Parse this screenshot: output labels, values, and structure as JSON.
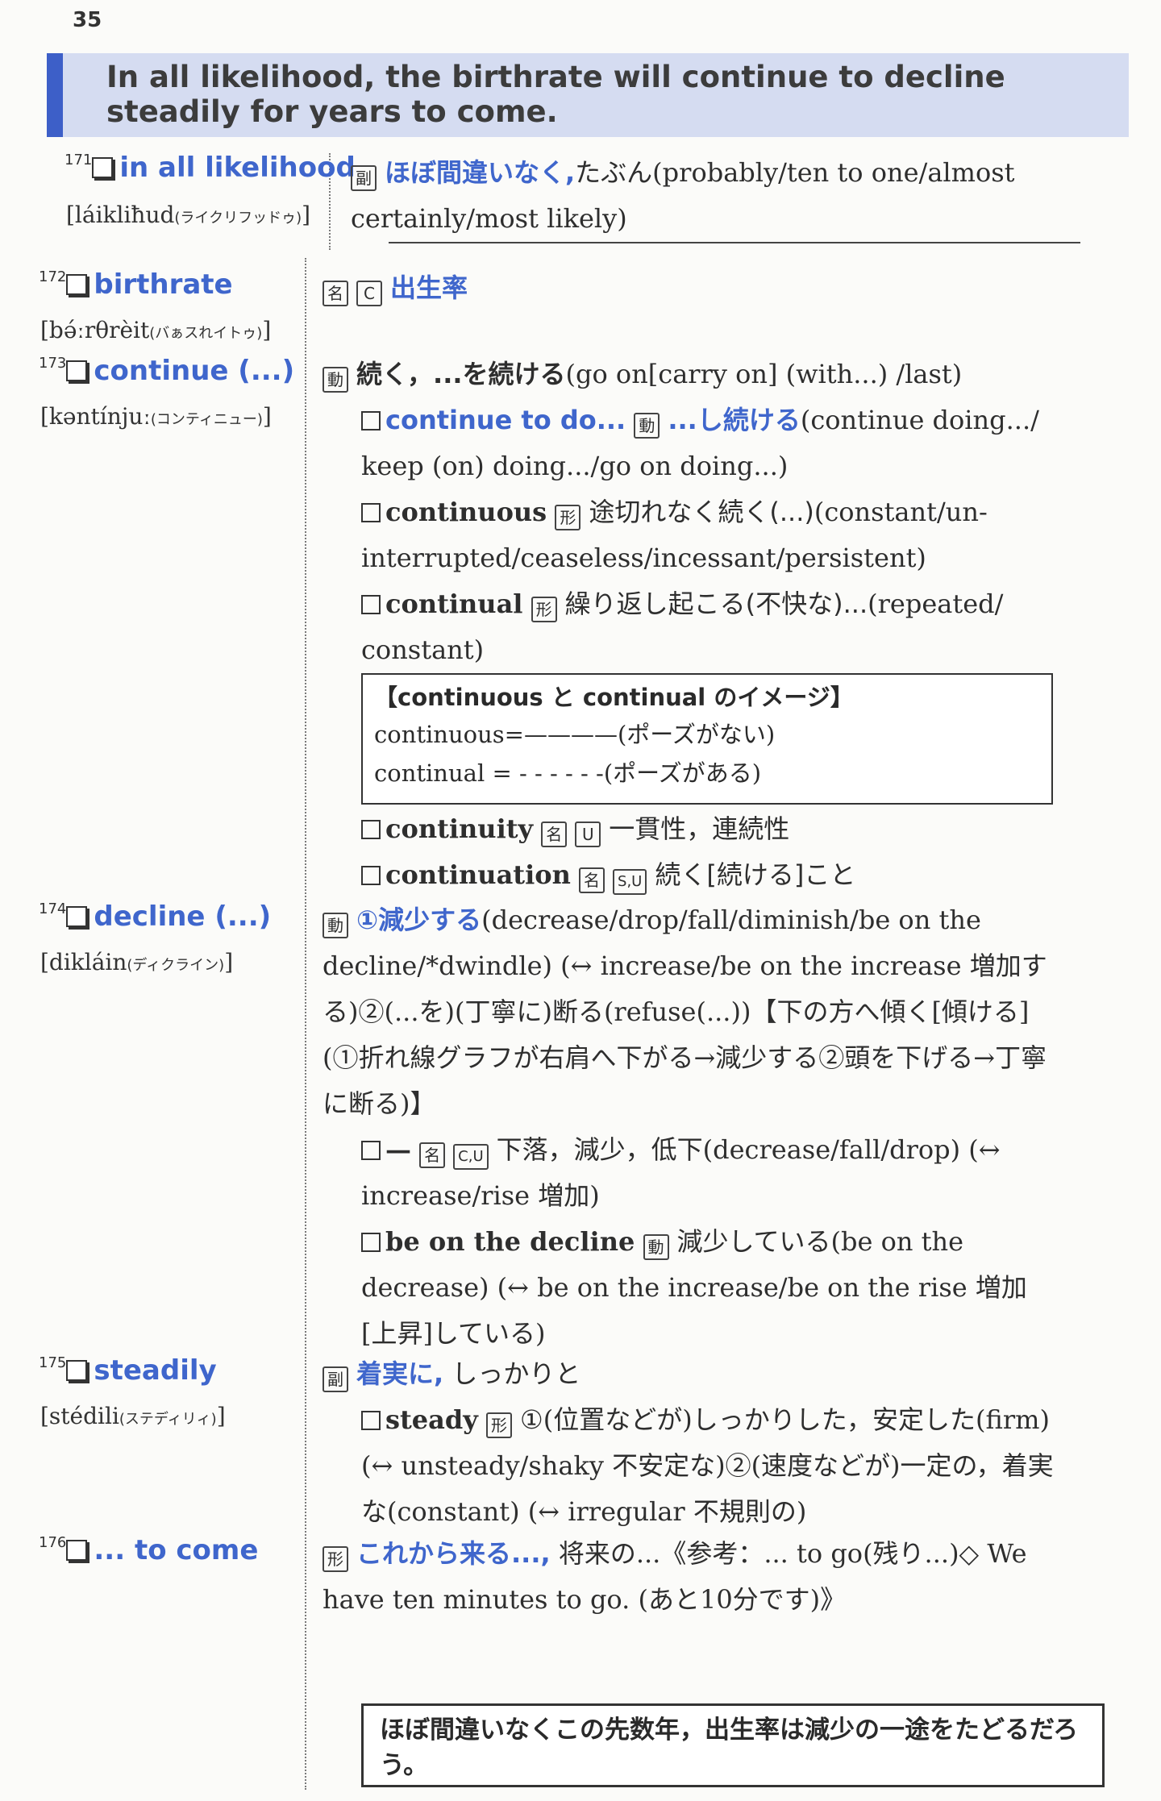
{
  "page_number": "35",
  "headline": "In all likelihood, the birthrate will continue to decline steadily for years to come.",
  "entries": [
    {
      "num": "171",
      "word": "in all likelihood",
      "pron": "[láikliħud",
      "pron_kana": "(ライクリフッドゥ)",
      "pron_end": "]",
      "pos": "副",
      "def_blue": "ほぼ間違いなく,",
      "def_rest": "たぶん(probably/ten to one/almost certainly/most likely)"
    },
    {
      "num": "172",
      "word": "birthrate",
      "pron": "[bə́ːrθrèit",
      "pron_kana": "(バぁスれイトゥ)",
      "pron_end": "]",
      "pos": "名",
      "pos2": "C",
      "def_blue": "出生率"
    },
    {
      "num": "173",
      "word": "continue (...)",
      "pron": "[kəntínjuː",
      "pron_kana": "(コンティニュー)",
      "pron_end": "]",
      "pos": "動",
      "def_main": "続く，...を続ける",
      "def_rest": "(go on[carry on] (with...) /last)",
      "sub1_word": "continue to do...",
      "sub1_pos": "動",
      "sub1_jp": "...し続ける",
      "sub1_rest": "(continue doing.../ keep (on) doing.../go on doing...)",
      "sub2_word": "continuous",
      "sub2_pos": "形",
      "sub2_jp": "途切れなく続く(...)",
      "sub2_rest": "(constant/un-interrupted/ceaseless/incessant/persistent)",
      "sub3_word": "continual",
      "sub3_pos": "形",
      "sub3_jp": "繰り返し起こる(不快な)...",
      "sub3_rest": "(repeated/ constant)",
      "image_title": "【continuous と continual のイメージ】",
      "image_line1": "continuous=————(ポーズがない)",
      "image_line2": "continual = - - - - - -(ポーズがある)",
      "sub4_word": "continuity",
      "sub4_pos": "名",
      "sub4_pos2": "U",
      "sub4_jp": "一貫性，連続性",
      "sub5_word": "continuation",
      "sub5_pos": "名",
      "sub5_pos2": "S,U",
      "sub5_jp": "続く[続ける]こと"
    },
    {
      "num": "174",
      "word": "decline (...)",
      "pron": "[dikláin",
      "pron_kana": "(ディクライン)",
      "pron_end": "]",
      "pos": "動",
      "def_blue": "①減少する",
      "def_rest": "(decrease/drop/fall/diminish/be on the decline/*dwindle) (↔ increase/be on the increase 増加する)②(...を)(丁寧に)断る(refuse(...))【下の方へ傾く[傾ける](①折れ線グラフが右肩へ下がる→減少する②頭を下げる→丁寧に断る)】",
      "sub1_word": "—",
      "sub1_pos": "名",
      "sub1_pos2": "C,U",
      "sub1_rest": "下落，減少，低下(decrease/fall/drop) (↔ increase/rise 増加)",
      "sub2_word": "be on the decline",
      "sub2_pos": "動",
      "sub2_rest": "減少している(be on the decrease) (↔ be on the increase/be on the rise 増加[上昇]している)"
    },
    {
      "num": "175",
      "word": "steadily",
      "pron": "[stédili",
      "pron_kana": "(ステディリィ)",
      "pron_end": "]",
      "pos": "副",
      "def_blue": "着実に,",
      "def_rest": "しっかりと",
      "sub1_word": "steady",
      "sub1_pos": "形",
      "sub1_rest": "①(位置などが)しっかりした，安定した(firm) (↔ unsteady/shaky 不安定な)②(速度などが)一定の，着実な(constant) (↔ irregular 不規則の)"
    },
    {
      "num": "176",
      "word": "... to come",
      "pos": "形",
      "def_blue": "これから来る...,",
      "def_rest": "将来の...《参考：... to go(残り...)◇ We have ten minutes to go. (あと10分です)》"
    }
  ],
  "translation": "ほぼ間違いなくこの先数年，出生率は減少の一途をたどるだろう。"
}
